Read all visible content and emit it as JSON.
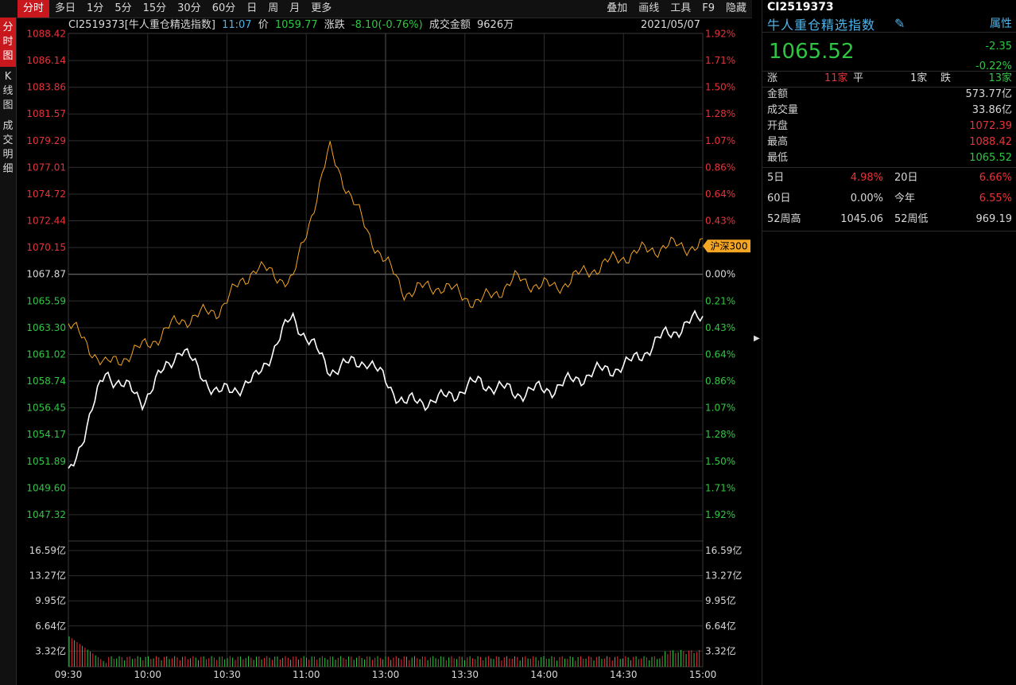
{
  "toolbar": {
    "tabs": [
      "分时",
      "多日",
      "1分",
      "5分",
      "15分",
      "30分",
      "60分",
      "日",
      "周",
      "月",
      "更多"
    ],
    "right_tools": [
      "叠加",
      "画线",
      "工具",
      "F9",
      "隐藏"
    ]
  },
  "sidebar": [
    {
      "label": [
        "分",
        "时",
        "图"
      ],
      "active": true
    },
    {
      "label": [
        "K",
        "线",
        "图"
      ],
      "active": false
    },
    {
      "label": [
        "成",
        "交",
        "明",
        "细"
      ],
      "active": false
    }
  ],
  "info": {
    "name": "CI2519373[牛人重仓精选指数]",
    "time": "11:07",
    "price_label": "价",
    "price": "1059.77",
    "change_label": "涨跌",
    "change": "-8.10(-0.76%)",
    "amount_label": "成交金额",
    "amount": "9626万",
    "date": "2021/05/07"
  },
  "axes": {
    "left_price": [
      "1088.42",
      "1086.14",
      "1083.86",
      "1081.57",
      "1079.29",
      "1077.01",
      "1074.72",
      "1072.44",
      "1070.15",
      "1067.87",
      "1065.59",
      "1063.30",
      "1061.02",
      "1058.74",
      "1056.45",
      "1054.17",
      "1051.89",
      "1049.60",
      "1047.32"
    ],
    "right_pct": [
      "1.92%",
      "1.71%",
      "1.50%",
      "1.28%",
      "1.07%",
      "0.86%",
      "0.64%",
      "0.43%",
      "0.21%",
      "0.00%",
      "0.21%",
      "0.43%",
      "0.64%",
      "0.86%",
      "1.07%",
      "1.28%",
      "1.50%",
      "1.71%",
      "1.92%"
    ],
    "volume": [
      "16.59亿",
      "13.27亿",
      "9.95亿",
      "6.64亿",
      "3.32亿"
    ],
    "time": [
      "09:30",
      "10:00",
      "10:30",
      "11:00",
      "13:00",
      "13:30",
      "14:00",
      "14:30",
      "15:00"
    ]
  },
  "overlay_tag": "沪深300",
  "chart_data": {
    "type": "line",
    "x": [
      "09:30",
      "10:00",
      "10:30",
      "11:00",
      "13:00",
      "13:30",
      "14:00",
      "14:30",
      "15:00"
    ],
    "ylim": [
      1047.32,
      1088.42
    ],
    "base": 1067.87,
    "series": [
      {
        "name": "CI2519373",
        "values": [
          1052.5,
          1061.0,
          1058.7,
          1063.0,
          1059.2,
          1060.3,
          1065.5,
          1061.2,
          1062.0,
          1058.5,
          1058.8,
          1060.2,
          1059.3,
          1059.7,
          1060.9,
          1061.6,
          1064.0,
          1065.5
        ]
      },
      {
        "name": "沪深300",
        "values": [
          1065.0,
          1061.5,
          1063.0,
          1065.2,
          1066.0,
          1069.5,
          1068.3,
          1079.0,
          1072.4,
          1067.5,
          1068.0,
          1066.6,
          1068.5,
          1067.8,
          1069.3,
          1070.5,
          1071.2,
          1071.2
        ]
      }
    ],
    "volume_ylim": [
      0,
      16.59
    ],
    "colors": {
      "main": "#ffffff",
      "overlay": "#f5a623",
      "up": "#e8323a",
      "down": "#2fc742",
      "grid": "#2e2e2e"
    }
  },
  "panel": {
    "code": "CI2519373",
    "name": "牛人重仓精选指数",
    "attr_label": "属性",
    "price": "1065.52",
    "change": "-2.35",
    "change_pct": "-0.22%",
    "breadth": {
      "up_label": "涨",
      "up": "11家",
      "flat_label": "平",
      "flat": "1家",
      "down_label": "跌",
      "down": "13家"
    },
    "stats": [
      {
        "label": "金额",
        "value": "573.77亿",
        "color": "white"
      },
      {
        "label": "成交量",
        "value": "33.86亿",
        "color": "white"
      },
      {
        "label": "开盘",
        "value": "1072.39",
        "color": "red"
      },
      {
        "label": "最高",
        "value": "1088.42",
        "color": "red"
      },
      {
        "label": "最低",
        "value": "1065.52",
        "color": "green"
      }
    ],
    "periods": [
      {
        "l1": "5日",
        "v1": "4.98%",
        "c1": "red",
        "l2": "20日",
        "v2": "6.66%",
        "c2": "red"
      },
      {
        "l1": "60日",
        "v1": "0.00%",
        "c1": "white",
        "l2": "今年",
        "v2": "6.55%",
        "c2": "red"
      },
      {
        "l1": "52周高",
        "v1": "1045.06",
        "c1": "white",
        "l2": "52周低",
        "v2": "969.19",
        "c2": "white"
      }
    ]
  }
}
